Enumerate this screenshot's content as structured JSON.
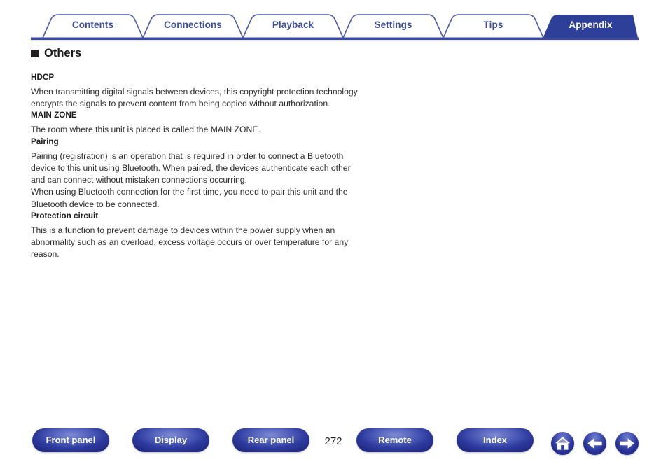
{
  "tabs": [
    {
      "label": "Contents",
      "active": false
    },
    {
      "label": "Connections",
      "active": false
    },
    {
      "label": "Playback",
      "active": false
    },
    {
      "label": "Settings",
      "active": false
    },
    {
      "label": "Tips",
      "active": false
    },
    {
      "label": "Appendix",
      "active": true
    }
  ],
  "content": {
    "heading": "Others",
    "entries": [
      {
        "term": "HDCP",
        "definition": "When transmitting digital signals between devices, this copyright protection technology encrypts the signals to prevent content from being copied without authorization."
      },
      {
        "term": "MAIN ZONE",
        "definition": "The room where this unit is placed is called the MAIN ZONE."
      },
      {
        "term": "Pairing",
        "definition": "Pairing (registration) is an operation that is required in order to connect a Bluetooth device to this unit using Bluetooth. When paired, the devices authenticate each other and can connect without mistaken connections occurring.\nWhen using Bluetooth connection for the first time, you need to pair this unit and the Bluetooth device to be connected."
      },
      {
        "term": "Protection circuit",
        "definition": "This is a function to prevent damage to devices within the power supply when an abnormality such as an overload, excess voltage occurs or over temperature for any reason."
      }
    ]
  },
  "footer": {
    "buttons": [
      {
        "label": "Front panel"
      },
      {
        "label": "Display"
      },
      {
        "label": "Rear panel"
      },
      {
        "label": "Remote"
      },
      {
        "label": "Index"
      }
    ],
    "page_number": "272",
    "icons": [
      {
        "name": "home-icon"
      },
      {
        "name": "arrow-left-icon"
      },
      {
        "name": "arrow-right-icon"
      }
    ]
  },
  "colors": {
    "tab_text": "#3f4f9e",
    "tab_active_bg": "#2e3f99",
    "tab_line": "#3b4a9e",
    "button_blue": "#2e3b9e",
    "body_text": "#2b2b2b"
  }
}
